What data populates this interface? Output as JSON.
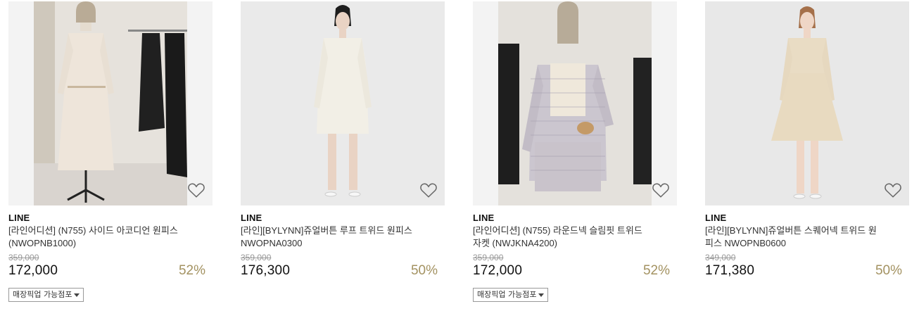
{
  "products": [
    {
      "brand": "LINE",
      "name": "[라인어디션] (N755) 사이드 아코디언 원피스 (NWOPNB1000)",
      "original_price": "359,000",
      "price": "172,000",
      "discount": "52%",
      "pickup_label": "매장픽업 가능점포",
      "wishlist_icon": "heart-outline-icon"
    },
    {
      "brand": "LINE",
      "name": "[라인][BYLYNN]쥬얼버튼 루프 트위드 원피스 NWOPNA0300",
      "original_price": "359,000",
      "price": "176,300",
      "discount": "50%",
      "wishlist_icon": "heart-outline-icon"
    },
    {
      "brand": "LINE",
      "name": "[라인어디션] (N755) 라운드넥 슬림핏 트위드 자켓 (NWJKNA4200)",
      "original_price": "359,000",
      "price": "172,000",
      "discount": "52%",
      "pickup_label": "매장픽업 가능점포",
      "wishlist_icon": "heart-outline-icon"
    },
    {
      "brand": "LINE",
      "name": "[라인][BYLYNN]쥬얼버튼 스퀘어넥 트위드 원피스 NWOPNB0600",
      "original_price": "349,000",
      "price": "171,380",
      "discount": "50%",
      "wishlist_icon": "heart-outline-icon"
    }
  ],
  "colors": {
    "discount": "#a39261",
    "original_price": "#999999",
    "thumb_bg": "#f1f1f1"
  }
}
